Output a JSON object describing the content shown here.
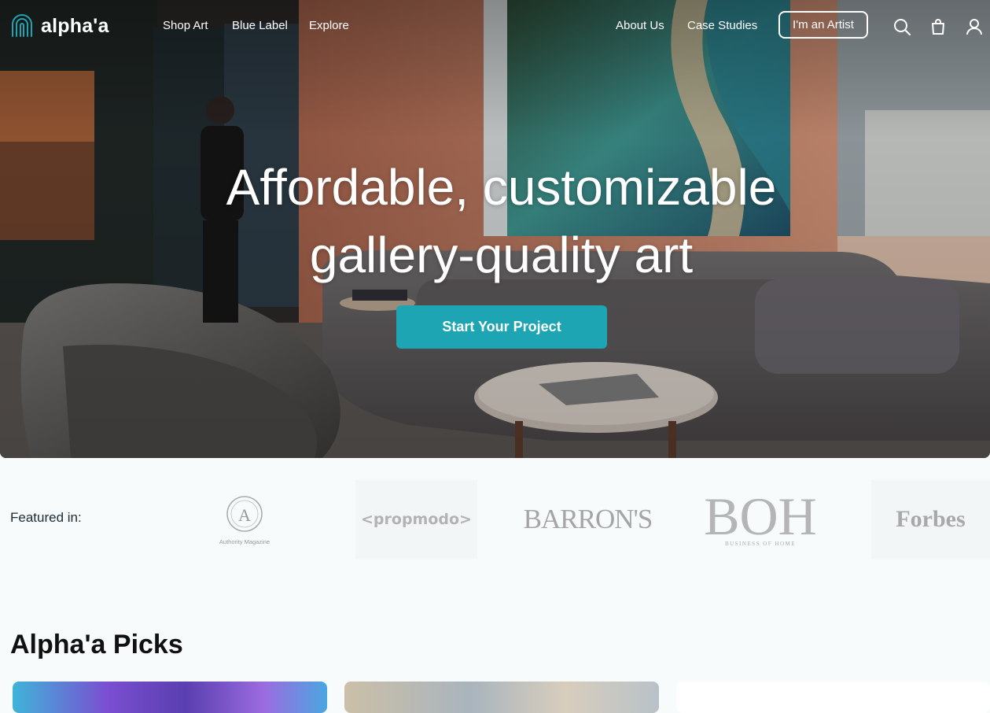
{
  "brand": {
    "name": "alpha'a",
    "accent": "#1ea5b3"
  },
  "nav": {
    "left_links": [
      "Shop Art",
      "Blue Label",
      "Explore"
    ],
    "right_links": [
      "About Us",
      "Case Studies"
    ],
    "artist_button": "I'm an Artist",
    "icons": [
      "search-icon",
      "shopping-bag-icon",
      "user-icon"
    ]
  },
  "hero": {
    "headline_line1": "Affordable, customizable",
    "headline_line2": "gallery-quality art",
    "cta_label": "Start Your Project"
  },
  "featured": {
    "label": "Featured in:",
    "logos": {
      "authority_letter": "A",
      "authority_name": "Authority Magazine",
      "propmodo": "<propmodo>",
      "barrons": "BARRON'S",
      "boh": "BOH",
      "boh_sub": "BUSINESS OF HOME",
      "forbes": "Forbes"
    }
  },
  "picks": {
    "title": "Alpha'a Picks"
  }
}
